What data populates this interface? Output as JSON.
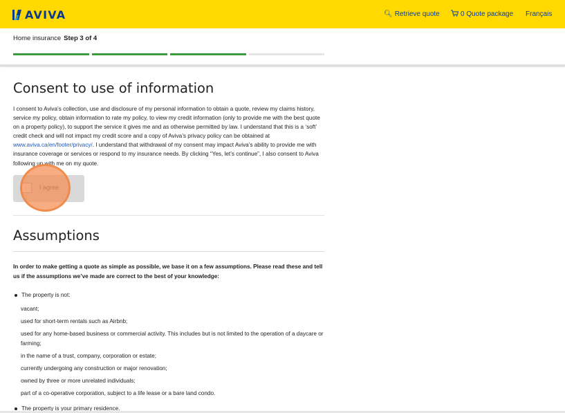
{
  "header": {
    "brand": "AVIVA",
    "retrieve_quote": "Retrieve quote",
    "quote_package": "0 Quote package",
    "language": "Français"
  },
  "progress": {
    "label": "Home insurance",
    "step": "Step 3 of 4",
    "completed": 3,
    "total": 4
  },
  "consent": {
    "title": "Consent to use of information",
    "text_before_link": "I consent to Aviva’s collection, use and disclosure of my personal information to obtain a quote, review my claims history, service my policy, obtain information to rate my policy, to view my credit information (only to provide me with the best quote on a property policy), to support the service it gives me and as otherwise permitted by law. I understand that this is a ‘soft’ credit check and will not impact my credit score and a copy of Aviva’s privacy policy can be obtained at ",
    "link": "www.aviva.ca/en/footer/privacy/",
    "text_after_link": ". I understand that withdrawal of my consent may impact Aviva’s ability to provide me with insurance coverage or services or respond to my insurance needs. By clicking “Yes, let’s continue”, I also consent to Aviva following up with me on my quote.",
    "agree_label": "I agree"
  },
  "assumptions": {
    "title": "Assumptions",
    "intro": "In order to make getting a quote as simple as possible, we base it on a few assumptions. Please read these and tell us if the assumptions we’ve made are correct to the best of your knowledge:",
    "bullet1": "The property is not:",
    "items": [
      "vacant;",
      "used for short-term rentals such as Airbnb;",
      "used for any home-based business or commercial activity. This includes but is not limited to the operation of a daycare or farming;",
      "in the name of a trust, company, corporation or estate;",
      "currently undergoing any construction or major renovation;",
      "owned by three or more unrelated individuals;",
      "part of a co-operative corporation, subject to a life lease or a bare land condo."
    ],
    "bullet2": "The property is your primary residence."
  },
  "colors": {
    "header_bg": "#ffd900",
    "brand_blue": "#0a3a8c",
    "progress_green": "#3c9c3c",
    "touch_indicator": "#f58c50"
  }
}
